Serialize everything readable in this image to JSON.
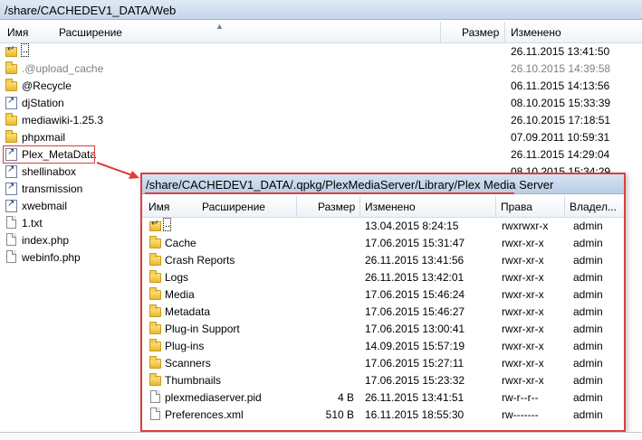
{
  "main": {
    "path": "/share/CACHEDEV1_DATA/Web",
    "columns": {
      "name": "Имя",
      "ext": "Расширение",
      "size": "Размер",
      "modified": "Изменено"
    },
    "rows": [
      {
        "name": "..",
        "date": "26.11.2015 13:41:50",
        "icon": "up",
        "grey": false
      },
      {
        "name": ".@upload_cache",
        "date": "26.10.2015 14:39:58",
        "icon": "folder",
        "grey": true
      },
      {
        "name": "@Recycle",
        "date": "06.11.2015 14:13:56",
        "icon": "folder",
        "grey": false
      },
      {
        "name": "djStation",
        "date": "08.10.2015 15:33:39",
        "icon": "link",
        "grey": false
      },
      {
        "name": "mediawiki-1.25.3",
        "date": "26.10.2015 17:18:51",
        "icon": "folder",
        "grey": false
      },
      {
        "name": "phpxmail",
        "date": "07.09.2011 10:59:31",
        "icon": "folder",
        "grey": false
      },
      {
        "name": "Plex_MetaData",
        "date": "26.11.2015 14:29:04",
        "icon": "link",
        "grey": false
      },
      {
        "name": "shellinabox",
        "date": "08.10.2015 15:34:29",
        "icon": "link",
        "grey": false
      },
      {
        "name": "transmission",
        "date": "",
        "icon": "link",
        "grey": false
      },
      {
        "name": "xwebmail",
        "date": "",
        "icon": "link",
        "grey": false
      },
      {
        "name": "1.txt",
        "date": "",
        "icon": "file",
        "grey": false
      },
      {
        "name": "index.php",
        "date": "",
        "icon": "file",
        "grey": false
      },
      {
        "name": "webinfo.php",
        "date": "",
        "icon": "file",
        "grey": false
      }
    ]
  },
  "overlay": {
    "path": "/share/CACHEDEV1_DATA/.qpkg/PlexMediaServer/Library/Plex Media Server",
    "columns": {
      "name": "Имя",
      "ext": "Расширение",
      "size": "Размер",
      "modified": "Изменено",
      "perms": "Права",
      "owner": "Владел..."
    },
    "rows": [
      {
        "name": "..",
        "size": "",
        "date": "13.04.2015 8:24:15",
        "perms": "rwxrwxr-x",
        "owner": "admin",
        "icon": "up"
      },
      {
        "name": "Cache",
        "size": "",
        "date": "17.06.2015 15:31:47",
        "perms": "rwxr-xr-x",
        "owner": "admin",
        "icon": "folder"
      },
      {
        "name": "Crash Reports",
        "size": "",
        "date": "26.11.2015 13:41:56",
        "perms": "rwxr-xr-x",
        "owner": "admin",
        "icon": "folder"
      },
      {
        "name": "Logs",
        "size": "",
        "date": "26.11.2015 13:42:01",
        "perms": "rwxr-xr-x",
        "owner": "admin",
        "icon": "folder"
      },
      {
        "name": "Media",
        "size": "",
        "date": "17.06.2015 15:46:24",
        "perms": "rwxr-xr-x",
        "owner": "admin",
        "icon": "folder"
      },
      {
        "name": "Metadata",
        "size": "",
        "date": "17.06.2015 15:46:27",
        "perms": "rwxr-xr-x",
        "owner": "admin",
        "icon": "folder"
      },
      {
        "name": "Plug-in Support",
        "size": "",
        "date": "17.06.2015 13:00:41",
        "perms": "rwxr-xr-x",
        "owner": "admin",
        "icon": "folder"
      },
      {
        "name": "Plug-ins",
        "size": "",
        "date": "14.09.2015 15:57:19",
        "perms": "rwxr-xr-x",
        "owner": "admin",
        "icon": "folder"
      },
      {
        "name": "Scanners",
        "size": "",
        "date": "17.06.2015 15:27:11",
        "perms": "rwxr-xr-x",
        "owner": "admin",
        "icon": "folder"
      },
      {
        "name": "Thumbnails",
        "size": "",
        "date": "17.06.2015 15:23:32",
        "perms": "rwxr-xr-x",
        "owner": "admin",
        "icon": "folder"
      },
      {
        "name": "plexmediaserver.pid",
        "size": "4 B",
        "date": "26.11.2015 13:41:51",
        "perms": "rw-r--r--",
        "owner": "admin",
        "icon": "file"
      },
      {
        "name": "Preferences.xml",
        "size": "510 B",
        "date": "16.11.2015 18:55:30",
        "perms": "rw-------",
        "owner": "admin",
        "icon": "file"
      }
    ]
  },
  "colors": {
    "annotation_red": "#d94040",
    "titlebar": "#c6d6ea"
  }
}
